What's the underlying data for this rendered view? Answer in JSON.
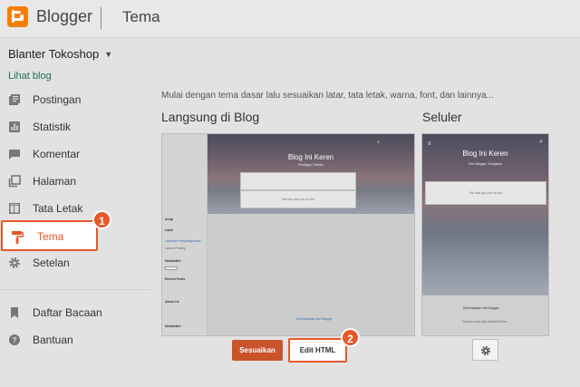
{
  "header": {
    "brand": "Blogger",
    "page_title": "Tema",
    "brand_color": "#f57d00"
  },
  "sidebar": {
    "blog_name": "Blanter Tokoshop",
    "view_blog": "Lihat blog",
    "items": [
      {
        "label": "Postingan",
        "icon": "posts-icon"
      },
      {
        "label": "Statistik",
        "icon": "stats-icon"
      },
      {
        "label": "Komentar",
        "icon": "comment-icon"
      },
      {
        "label": "Halaman",
        "icon": "pages-icon"
      },
      {
        "label": "Tata Letak",
        "icon": "layout-icon"
      },
      {
        "label": "Tema",
        "icon": "paint-roller-icon",
        "active": true
      },
      {
        "label": "Setelan",
        "icon": "gear-icon"
      }
    ],
    "secondary": [
      {
        "label": "Daftar Bacaan",
        "icon": "bookmark-icon"
      },
      {
        "label": "Bantuan",
        "icon": "help-icon"
      }
    ]
  },
  "main": {
    "intro": "Mulai dengan tema dasar lalu sesuaikan latar, tata letak, warna, font, dan lainnya...",
    "live_title": "Langsung di Blog",
    "mobile_title": "Seluler",
    "desktop_preview": {
      "hero_title": "Blog Ini Keren",
      "hero_subtitle": "Postingan Terbaru",
      "search_card": "",
      "post_card": "Tak ada apa pun di sini!",
      "sidebar_labels": [
        "Arsip",
        "Label",
        "Laporkan Penyalahgunaan",
        "Jumlah Posting",
        "Newsletter",
        "Recent Posts",
        "About Us",
        "Newsletter"
      ],
      "footer": "Diberdayakan oleh Blogger"
    },
    "mobile_preview": {
      "hero_title": "Blog Ini Keren",
      "hero_subtitle": "Free Blogger Templates",
      "card_text": "Tak ada apa pun di sini!",
      "footer_powered": "Diberdayakan oleh Blogger",
      "footer_theme": "Gambar tema oleh Michael Elkan"
    },
    "buttons": {
      "customize": "Sesuaikan",
      "edit_html": "Edit HTML"
    },
    "annotations": [
      "1",
      "2"
    ],
    "accent_color": "#e6582a"
  }
}
